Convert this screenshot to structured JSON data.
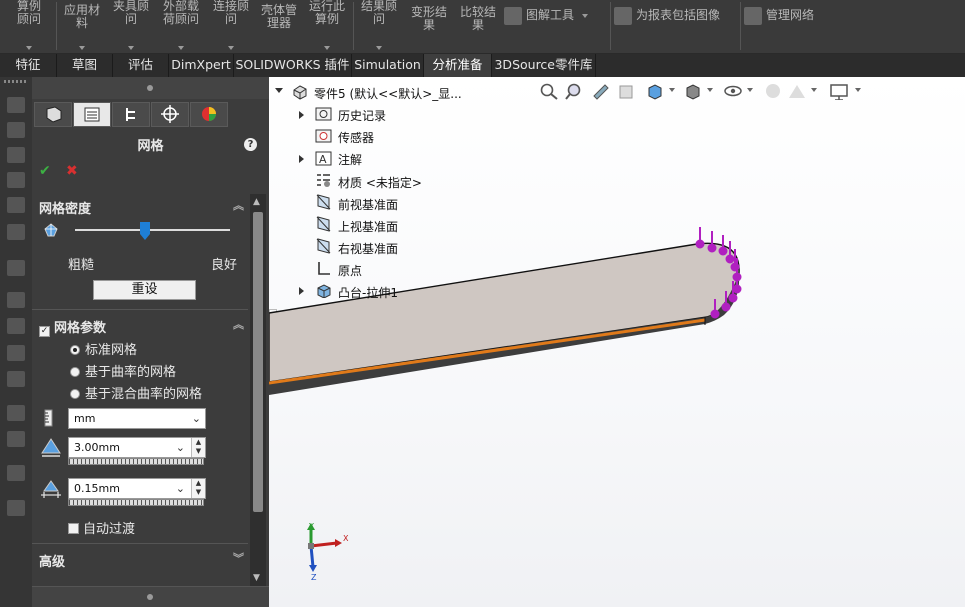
{
  "ribbon": {
    "items": [
      {
        "label": "算例顾问"
      },
      {
        "label": "应用材料"
      },
      {
        "label": "夹具顾问"
      },
      {
        "label": "外部载荷顾问"
      },
      {
        "label": "连接顾问"
      },
      {
        "label": "壳体管理器"
      },
      {
        "label": "运行此算例"
      },
      {
        "label": "结果顾问"
      },
      {
        "label": "变形结果"
      },
      {
        "label": "比较结果"
      },
      {
        "label": "图解工具"
      },
      {
        "label": "为报表包括图像"
      },
      {
        "label": "管理网络"
      }
    ]
  },
  "tabs": [
    {
      "label": "特征"
    },
    {
      "label": "草图"
    },
    {
      "label": "评估"
    },
    {
      "label": "DimXpert"
    },
    {
      "label": "SOLIDWORKS 插件"
    },
    {
      "label": "Simulation"
    },
    {
      "label": "分析准备",
      "active": true
    },
    {
      "label": "3DSource零件库"
    }
  ],
  "pm": {
    "title": "网格",
    "density_title": "网格密度",
    "density_value": 0.45,
    "coarse_label": "粗糙",
    "fine_label": "良好",
    "reset_label": "重设",
    "params_title": "网格参数",
    "params_checked": true,
    "radio_standard": "标准网格",
    "radio_curvature": "基于曲率的网格",
    "radio_blended": "基于混合曲率的网格",
    "unit_value": "mm",
    "size_value": "3.00mm",
    "tolerance_value": "0.15mm",
    "auto_transition": "自动过渡",
    "advanced_title": "高级"
  },
  "tree": {
    "part": "零件5 (默认<<默认>_显...",
    "items": [
      {
        "label": "历史记录"
      },
      {
        "label": "传感器"
      },
      {
        "label": "注解"
      },
      {
        "label": "材质 <未指定>"
      },
      {
        "label": "前视基准面"
      },
      {
        "label": "上视基准面"
      },
      {
        "label": "右视基准面"
      },
      {
        "label": "原点"
      },
      {
        "label": "凸台-拉伸1"
      }
    ]
  },
  "triad": {
    "x": "X",
    "y": "Y",
    "z": "Z"
  },
  "colors": {
    "load_arrow": "#b020c0",
    "body_face": "#cfc7c2",
    "edge": "#e07a1a",
    "accent": "#1e7fd6"
  }
}
